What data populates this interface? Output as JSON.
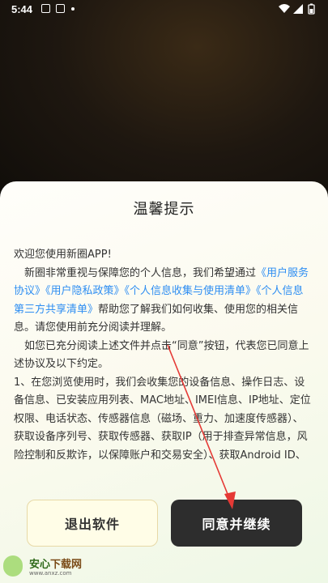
{
  "status_bar": {
    "time": "5:44",
    "icons": [
      "gallery-notification-icon",
      "a-notification-icon",
      "dot-icon",
      "wifi-icon",
      "signal-icon",
      "battery-icon"
    ]
  },
  "dialog": {
    "title": "温馨提示",
    "greeting": "欢迎您使用新圈APP!",
    "p1_pre": "新圈非常重视与保障您的个人信息，我们希望通过",
    "link_service": "《用户服务协议》",
    "link_privacy": "《用户隐私政策》",
    "link_collect": "《个人信息收集与使用清单》",
    "link_third": "《个人信息第三方共享清单》",
    "p1_post": "帮助您了解我们如何收集、使用您的相关信息。请您使用前充分阅读并理解。",
    "p2": "如您已充分阅读上述文件并点击“同意”按钮，代表您已同意上述协议及以下约定。",
    "p3": "1、在您浏览使用时，我们会收集您的设备信息、操作日志、设备信息、已安装应用列表、MAC地址、IMEI信息、IP地址、定位权限、电话状态、传感器信息（磁场、重力、加速度传感器）、获取设备序列号、获取传感器、获取IP（用于排查异常信息，风险控制和反欺诈，以保障账户和交易安全）、获取Android ID、"
  },
  "buttons": {
    "exit": "退出软件",
    "agree": "同意并继续"
  },
  "watermark": {
    "name_part1": "安心",
    "name_part2": "下载网",
    "url": "www.anxz.com"
  },
  "colors": {
    "link": "#2e8ef2",
    "agree_button": "#2d2d2d",
    "exit_button": "#fffde7",
    "annotation_arrow": "#e53935"
  }
}
